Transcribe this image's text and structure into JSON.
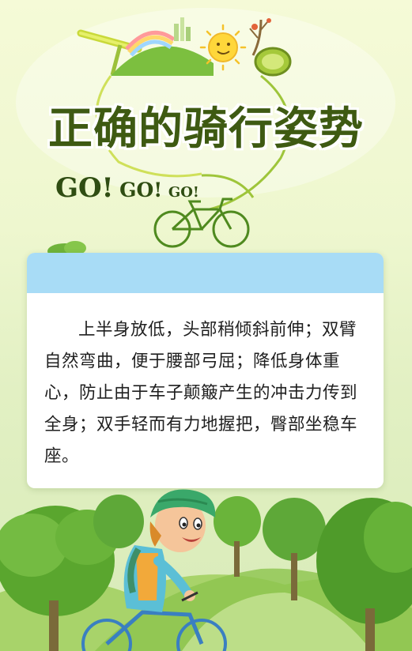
{
  "title": "正确的骑行姿势",
  "go": {
    "first": "GO!",
    "second": "GO!",
    "third": "GO!"
  },
  "card": {
    "text": "上半身放低，头部稍倾斜前伸；双臂自然弯曲，便于腰部弓屈；降低身体重心，防止由于车子颠簸产生的冲击力传到全身；双手轻而有力地握把，臀部坐稳车座。"
  },
  "colors": {
    "title": "#3e5a12",
    "card_header": "#a8dcf6",
    "grass": "#7cbf3f",
    "tree": "#5aa62e"
  }
}
